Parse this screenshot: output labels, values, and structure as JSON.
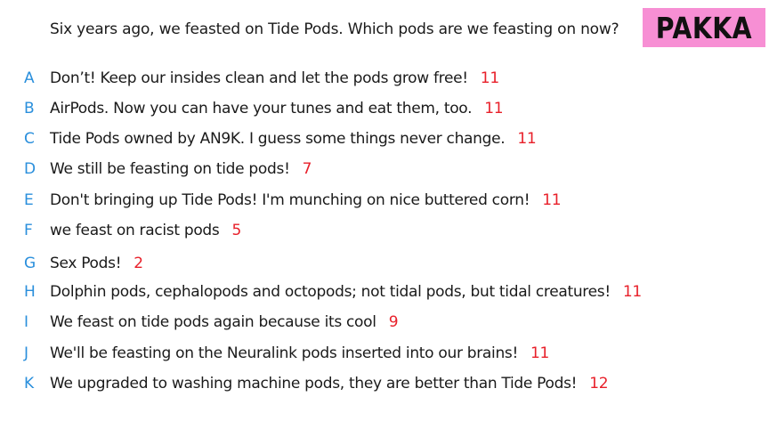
{
  "question": "Six years ago, we feasted on Tide Pods. Which pods are we feasting on now?",
  "badge": "PAKKA",
  "colors": {
    "badge_bg": "#f78fd4",
    "letter": "#2a8fdc",
    "count": "#e8202a",
    "text": "#1a1a1a"
  },
  "answers": [
    {
      "letter": "A",
      "text": "Don’t! Keep our insides clean and let the pods grow free!",
      "count": "11"
    },
    {
      "letter": "B",
      "text": "AirPods. Now you can have your tunes and eat them, too.",
      "count": "11"
    },
    {
      "letter": "C",
      "text": "Tide Pods owned by AN9K. I guess some things never change.",
      "count": "11"
    },
    {
      "letter": "D",
      "text": "We still be feasting on tide pods!",
      "count": "7"
    },
    {
      "letter": "E",
      "text": "Don't bringing up Tide Pods! I'm munching on nice buttered corn!",
      "count": "11"
    },
    {
      "letter": "F",
      "text": "we feast on racist pods",
      "count": "5"
    },
    {
      "letter": "G",
      "text": "Sex Pods!",
      "count": "2"
    },
    {
      "letter": "H",
      "text": "Dolphin pods, cephalopods and octopods; not tidal pods, but tidal creatures!",
      "count": "11"
    },
    {
      "letter": "I",
      "text": "We feast on tide pods again because its cool",
      "count": "9"
    },
    {
      "letter": "J",
      "text": "We'll be feasting on the Neuralink pods inserted into our brains!",
      "count": "11"
    },
    {
      "letter": "K",
      "text": "We upgraded to washing machine pods, they are better than Tide Pods!",
      "count": "12"
    }
  ]
}
